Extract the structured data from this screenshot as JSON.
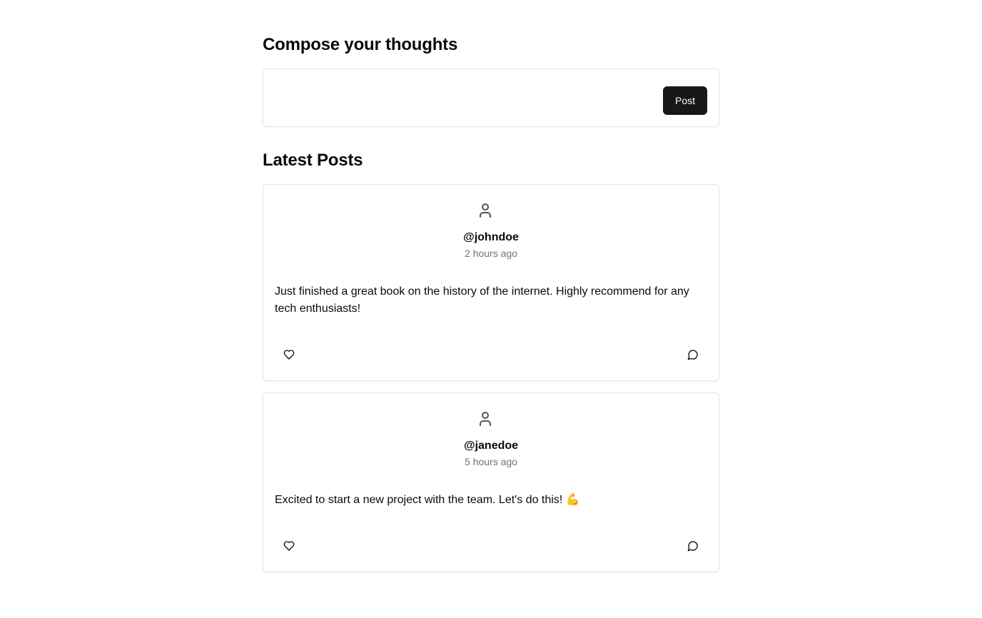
{
  "compose": {
    "title": "Compose your thoughts",
    "input_value": "",
    "input_placeholder": "",
    "post_button_label": "Post"
  },
  "feed": {
    "title": "Latest Posts",
    "posts": [
      {
        "username": "@johndoe",
        "time": "2 hours ago",
        "body": "Just finished a great book on the history of the internet. Highly recommend for any tech enthusiasts!",
        "avatar_icon": "user-icon",
        "like_icon": "heart-icon",
        "comment_icon": "message-circle-icon"
      },
      {
        "username": "@janedoe",
        "time": "5 hours ago",
        "body": "Excited to start a new project with the team. Let's do this! 💪",
        "avatar_icon": "user-icon",
        "like_icon": "heart-icon",
        "comment_icon": "message-circle-icon"
      }
    ]
  },
  "colors": {
    "primary_button_bg": "#18181b",
    "primary_button_text": "#fafafa",
    "border": "#e4e4e7",
    "muted_text": "#71717a",
    "text": "#0a0a0a"
  }
}
